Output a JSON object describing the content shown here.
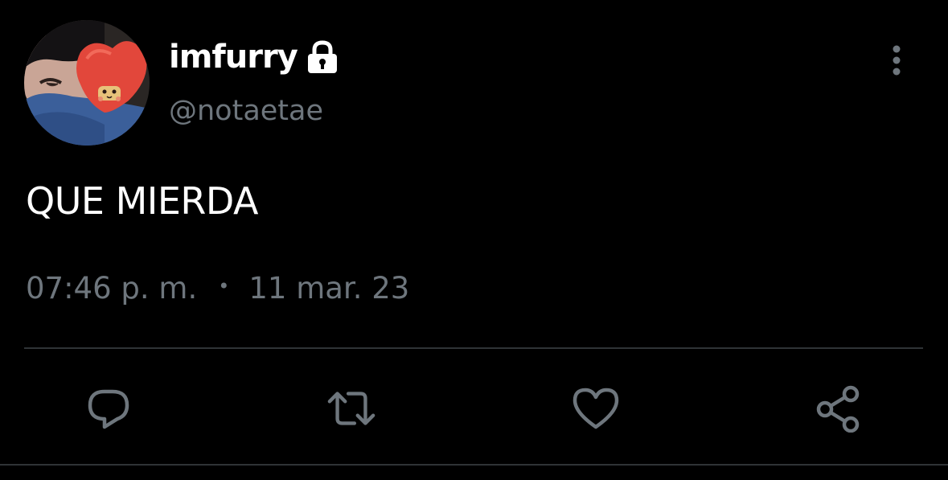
{
  "tweet": {
    "display_name": "imfurry",
    "handle": "@notaetae",
    "text": "QUE MIERDA",
    "time": "07:46 p. m.",
    "separator": "•",
    "date": "11 mar. 23",
    "protected": true
  },
  "icons": {
    "lock": "lock-icon",
    "more": "more-vertical-icon",
    "reply": "reply-icon",
    "retweet": "retweet-icon",
    "like": "heart-icon",
    "share": "share-icon"
  },
  "colors": {
    "background": "#000000",
    "primary_text": "#ffffff",
    "secondary_text": "#6e767d",
    "divider": "#2f3336"
  }
}
